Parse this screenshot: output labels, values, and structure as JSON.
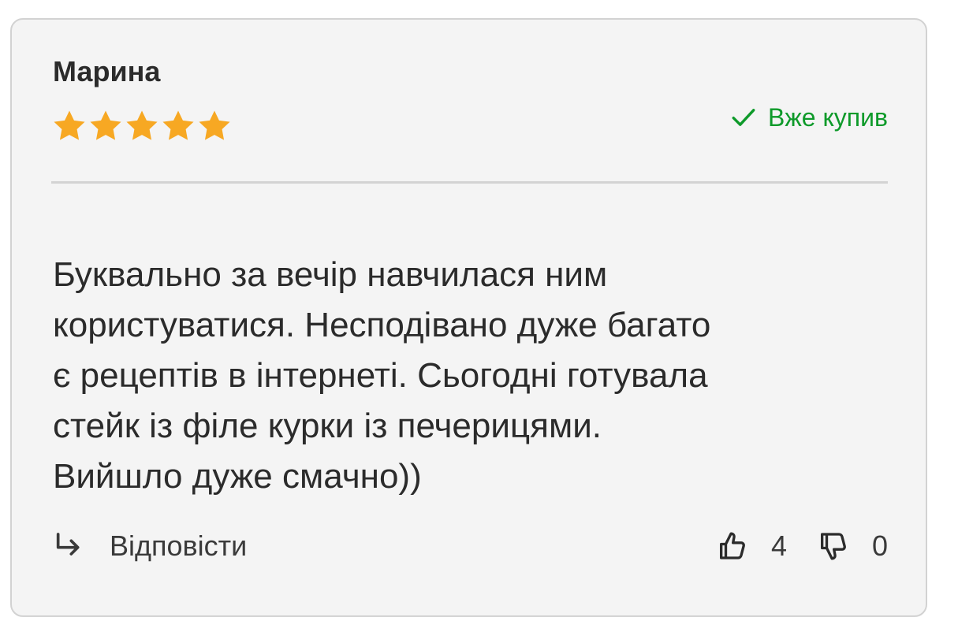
{
  "review": {
    "author": "Марина",
    "rating": 5,
    "rating_max": 5,
    "purchased_label": "Вже купив",
    "text": "Буквально за вечір навчилася ним\nкористуватися. Несподівано дуже багато\nє рецептів в інтернеті. Сьогодні готувала\nстейк із філе курки із печерицями.\nВийшло дуже смачно))",
    "reply_label": "Відповісти",
    "likes": "4",
    "dislikes": "0"
  },
  "colors": {
    "star": "#f7a823",
    "purchased": "#0e9a2a",
    "text": "#2b2b2b",
    "card_background": "#f4f4f4"
  },
  "icons": {
    "star": "star-icon",
    "purchased": "check-icon",
    "reply": "reply-arrow-icon",
    "like": "thumbs-up-icon",
    "dislike": "thumbs-down-icon"
  }
}
